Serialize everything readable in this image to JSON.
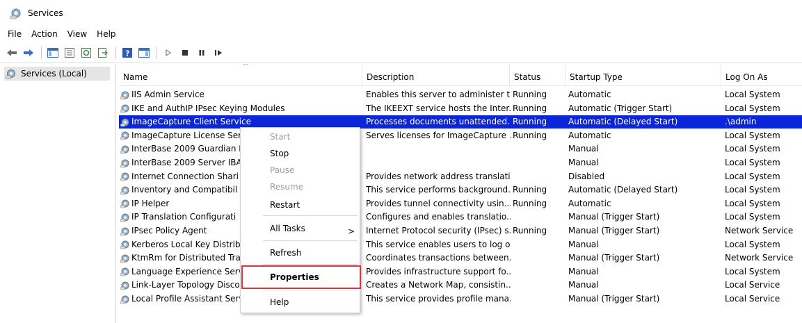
{
  "window": {
    "title": "Services"
  },
  "menu": [
    "File",
    "Action",
    "View",
    "Help"
  ],
  "tree": {
    "label": "Services (Local)"
  },
  "columns": {
    "name": "Name",
    "description": "Description",
    "status": "Status",
    "startup": "Startup Type",
    "logon": "Log On As"
  },
  "rows": [
    {
      "name": "IIS Admin Service",
      "description": "Enables this server to administer t...",
      "status": "Running",
      "startup": "Automatic",
      "logon": "Local System"
    },
    {
      "name": "IKE and AuthIP IPsec Keying Modules",
      "description": "The IKEEXT service hosts the Inter...",
      "status": "Running",
      "startup": "Automatic (Trigger Start)",
      "logon": "Local System"
    },
    {
      "name": "ImageCapture Client Service",
      "description": "Processes documents unattended.",
      "status": "Running",
      "startup": "Automatic (Delayed Start)",
      "logon": ".\\admin",
      "selected": true
    },
    {
      "name": "ImageCapture License Ser",
      "description": "Serves licenses for ImageCapture ...",
      "status": "Running",
      "startup": "Automatic",
      "logon": "Local System"
    },
    {
      "name": "InterBase 2009 Guardian IE",
      "description": "",
      "status": "",
      "startup": "Manual",
      "logon": "Local System"
    },
    {
      "name": "InterBase 2009 Server IBAE",
      "description": "",
      "status": "",
      "startup": "Manual",
      "logon": "Local System"
    },
    {
      "name": "Internet Connection Shari",
      "description": "Provides network address translati...",
      "status": "",
      "startup": "Disabled",
      "logon": "Local System"
    },
    {
      "name": "Inventory and Compatibil",
      "description": "This service performs background...",
      "status": "Running",
      "startup": "Automatic (Delayed Start)",
      "logon": "Local System"
    },
    {
      "name": "IP Helper",
      "description": "Provides tunnel connectivity usin...",
      "status": "Running",
      "startup": "Automatic",
      "logon": "Local System"
    },
    {
      "name": "IP Translation Configurati",
      "description": "Configures and enables translatio...",
      "status": "",
      "startup": "Manual (Trigger Start)",
      "logon": "Local System"
    },
    {
      "name": "IPsec Policy Agent",
      "description": "Internet Protocol security (IPsec) s...",
      "status": "Running",
      "startup": "Manual (Trigger Start)",
      "logon": "Network Service"
    },
    {
      "name": "Kerberos Local Key Distrib",
      "description": "This service enables users to log o...",
      "status": "",
      "startup": "Manual",
      "logon": "Local System"
    },
    {
      "name": "KtmRm for Distributed Tra",
      "description": "Coordinates transactions between...",
      "status": "",
      "startup": "Manual (Trigger Start)",
      "logon": "Network Service"
    },
    {
      "name": "Language Experience Serv",
      "description": "Provides infrastructure support fo...",
      "status": "",
      "startup": "Manual",
      "logon": "Local System"
    },
    {
      "name": "Link-Layer Topology Disco",
      "description": "Creates a Network Map, consistin...",
      "status": "",
      "startup": "Manual",
      "logon": "Local Service"
    },
    {
      "name": "Local Profile Assistant Service",
      "description": "This service provides profile mana...",
      "status": "",
      "startup": "Manual (Trigger Start)",
      "logon": "Local Service"
    }
  ],
  "context_menu": {
    "start": "Start",
    "stop": "Stop",
    "pause": "Pause",
    "resume": "Resume",
    "restart": "Restart",
    "all_tasks": "All Tasks",
    "refresh": "Refresh",
    "properties": "Properties",
    "help": "Help"
  },
  "colors": {
    "selection": "#0b26d8",
    "highlight": "#e0323a"
  }
}
